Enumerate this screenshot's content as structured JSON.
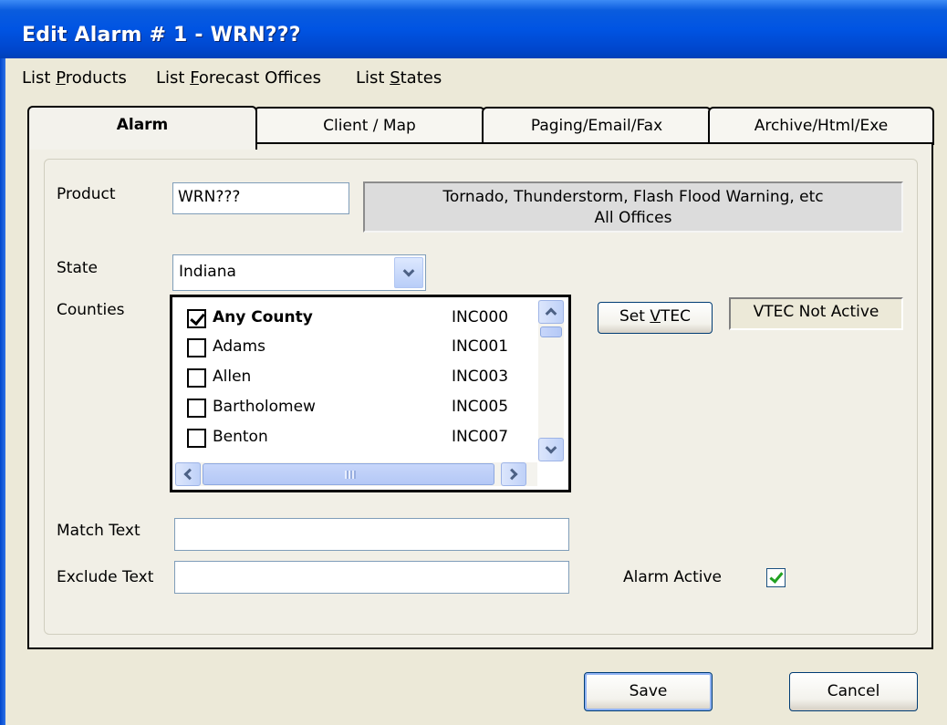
{
  "window": {
    "title": "Edit Alarm # 1 - WRN???"
  },
  "menu": [
    {
      "pre": "List ",
      "key": "P",
      "post": "roducts"
    },
    {
      "pre": "List ",
      "key": "F",
      "post": "orecast Offices"
    },
    {
      "pre": "List ",
      "key": "S",
      "post": "tates"
    }
  ],
  "tabs": [
    {
      "label": "Alarm",
      "active": true
    },
    {
      "label": "Client / Map",
      "active": false
    },
    {
      "label": "Paging/Email/Fax",
      "active": false
    },
    {
      "label": "Archive/Html/Exe",
      "active": false
    }
  ],
  "form": {
    "product_label": "Product",
    "product_value": "WRN???",
    "product_desc_line1": "Tornado, Thunderstorm, Flash Flood Warning, etc",
    "product_desc_line2": "All Offices",
    "state_label": "State",
    "state_value": "Indiana",
    "counties_label": "Counties",
    "match_text_label": "Match Text",
    "match_text_value": "",
    "exclude_text_label": "Exclude Text",
    "exclude_text_value": "",
    "alarm_active_label": "Alarm Active",
    "alarm_active_checked": true
  },
  "counties": [
    {
      "name": "Any County",
      "code": "INC000",
      "checked": true,
      "bold": true
    },
    {
      "name": "Adams",
      "code": "INC001",
      "checked": false,
      "bold": false
    },
    {
      "name": "Allen",
      "code": "INC003",
      "checked": false,
      "bold": false
    },
    {
      "name": "Bartholomew",
      "code": "INC005",
      "checked": false,
      "bold": false
    },
    {
      "name": "Benton",
      "code": "INC007",
      "checked": false,
      "bold": false
    }
  ],
  "vtec": {
    "button_pre": "Set ",
    "button_key": "V",
    "button_post": "TEC",
    "status": "VTEC Not Active"
  },
  "buttons": {
    "save": "Save",
    "cancel": "Cancel"
  },
  "colors": {
    "titlebar": "#0054E3",
    "dialog_bg": "#ECE9D8",
    "check_green": "#21A121"
  }
}
